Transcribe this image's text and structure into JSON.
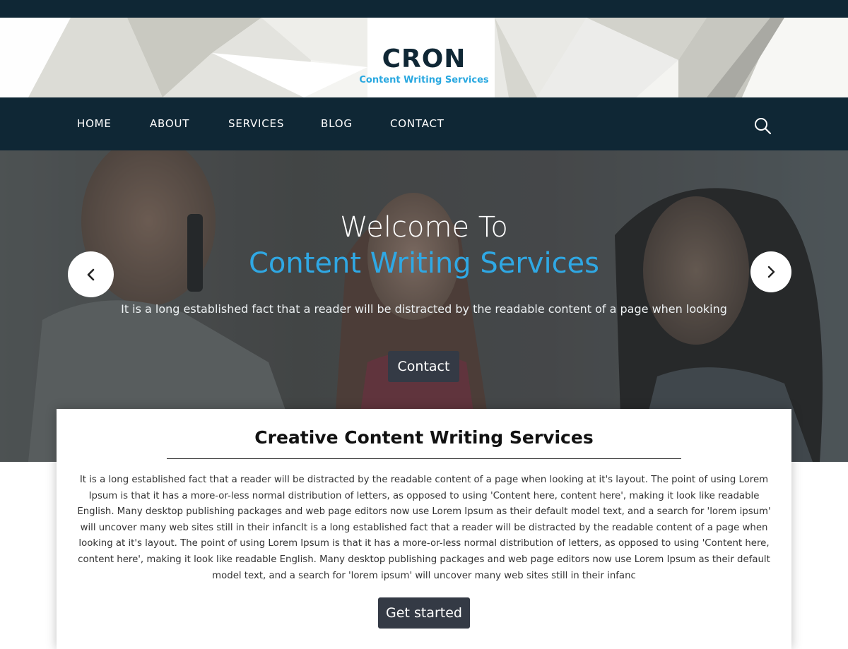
{
  "brand": {
    "name": "CRON",
    "tagline": "Content Writing Services"
  },
  "nav": {
    "items": [
      {
        "label": "HOME"
      },
      {
        "label": "ABOUT"
      },
      {
        "label": "SERVICES"
      },
      {
        "label": "BLOG"
      },
      {
        "label": "CONTACT"
      }
    ],
    "search_icon": "search-icon"
  },
  "hero": {
    "title_line1": "Welcome To",
    "title_line2": "Content Writing Services",
    "text": "It is a long established fact that a reader will be distracted by the readable content of a page when looking",
    "button_label": "Contact",
    "prev_icon": "chevron-left-icon",
    "next_icon": "chevron-right-icon"
  },
  "section": {
    "title": "Creative Content Writing Services",
    "body": "It is a long established fact that a reader will be distracted by the readable content of a page when looking at it's layout. The point of using Lorem Ipsum is that it has a more-or-less normal distribution of letters, as opposed to using 'Content here, content here', making it look like readable English. Many desktop publishing packages and web page editors now use Lorem Ipsum as their default model text, and a search for 'lorem ipsum' will uncover many web sites still in their infancIt is a long established fact that a reader will be distracted by the readable content of a page when looking at it's layout. The point of using Lorem Ipsum is that it has a more-or-less normal distribution of letters, as opposed to using 'Content here, content here', making it look like readable English. Many desktop publishing packages and web page editors now use Lorem Ipsum as their default model text, and a search for 'lorem ipsum' will uncover many web sites still in their infanc",
    "button_label": "Get started"
  },
  "colors": {
    "navy": "#0f2735",
    "accent_blue": "#2fa8e4",
    "button_dark": "#343a45"
  }
}
